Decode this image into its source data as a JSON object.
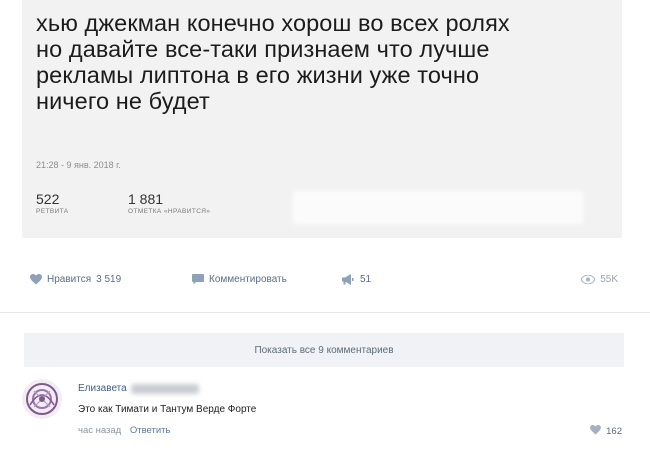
{
  "tweet": {
    "text": "хью джекман конечно хорош во всех ролях\nно давайте все-таки признаем что лучше\nрекламы липтона в его жизни уже точно\nничего не будет",
    "timestamp": "21:28 - 9 янв. 2018 г.",
    "retweets_count": "522",
    "retweets_label": "РЕТВИТА",
    "likes_count": "1 881",
    "likes_label": "ОТМЕТКА «НРАВИТСЯ»"
  },
  "actions": {
    "like_label": "Нравится",
    "like_count": "3 519",
    "comment_label": "Комментировать",
    "share_count": "51",
    "views_count": "55K"
  },
  "comments": {
    "show_all_label": "Показать все 9 комментариев",
    "items": [
      {
        "author_first_name": "Елизавета",
        "text": "Это как Тимати и Тантум Верде Форте",
        "time": "час назад",
        "reply_label": "Ответить",
        "likes": "162"
      }
    ]
  },
  "colors": {
    "link": "#3e5f8a",
    "icon": "#8fa1b6",
    "card_bg": "#f2f2f2"
  }
}
